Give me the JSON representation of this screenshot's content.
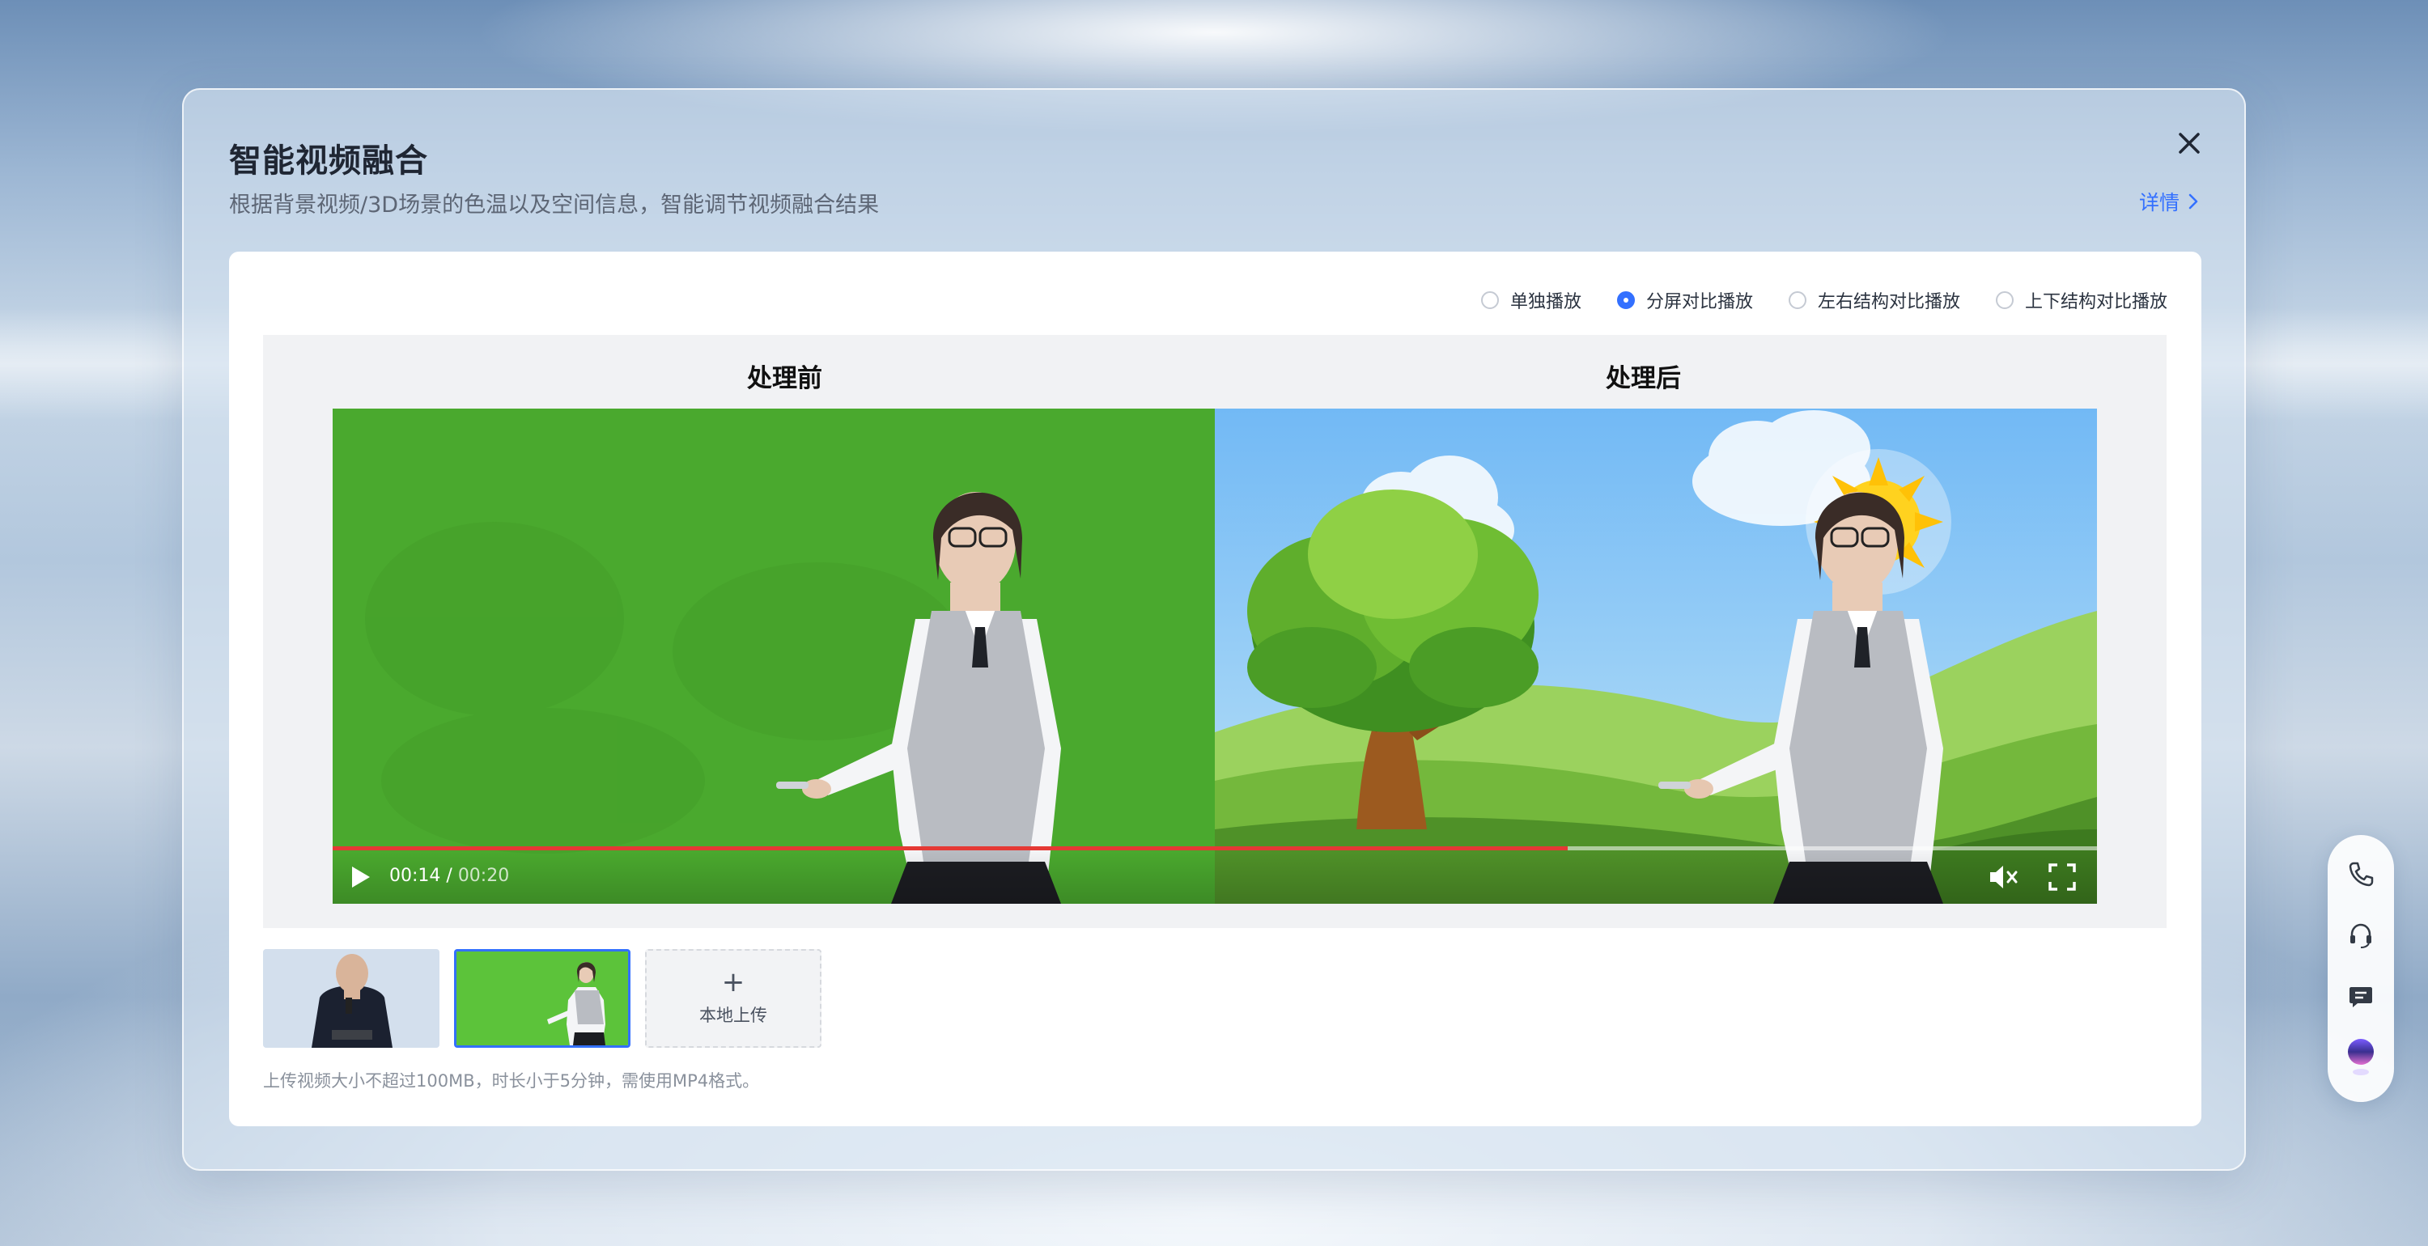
{
  "dialog": {
    "title": "智能视频融合",
    "subtitle": "根据背景视频/3D场景的色温以及空间信息，智能调节视频融合结果",
    "detail_link": "详情",
    "close_icon": "close-icon"
  },
  "playback_modes": {
    "options": [
      "单独播放",
      "分屏对比播放",
      "左右结构对比播放",
      "上下结构对比播放"
    ],
    "selected": "分屏对比播放"
  },
  "player": {
    "before_label": "处理前",
    "after_label": "处理后",
    "current_time": "00:14",
    "separator": " / ",
    "duration": "00:20",
    "progress": 0.7,
    "icons": [
      "play-icon",
      "mute-icon",
      "fullscreen-icon"
    ],
    "progress_color": "#e53935"
  },
  "thumbnails": {
    "selected_index": 1,
    "upload_label": "本地上传"
  },
  "hint": "上传视频大小不超过100MB，时长小于5分钟，需使用MP4格式。",
  "side_toolbar": {
    "icons": [
      "phone-icon",
      "headset-icon",
      "chat-icon",
      "assistant-orb-icon"
    ]
  },
  "colors": {
    "accent": "#3370ff",
    "green_screen": "#4aa92e",
    "sky": "#78bff7"
  }
}
